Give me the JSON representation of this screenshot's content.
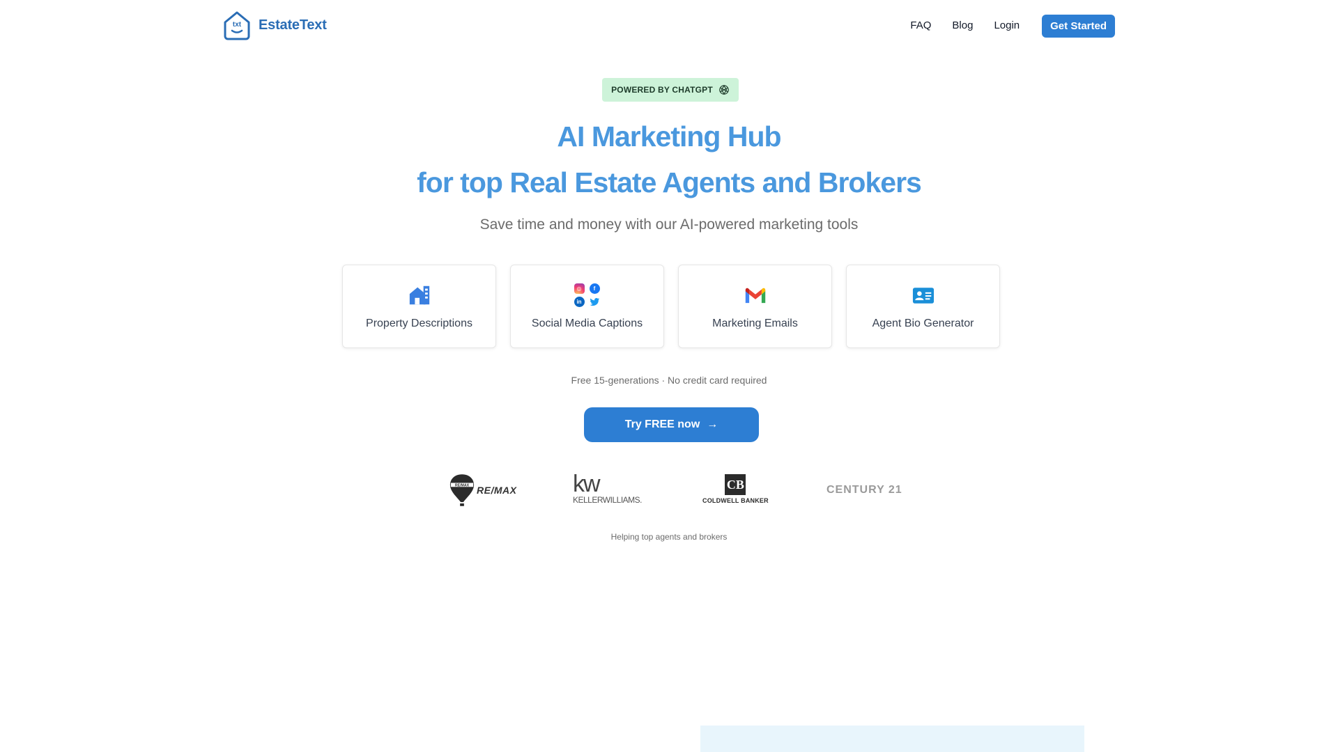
{
  "nav": {
    "logo_text": "EstateText",
    "links": [
      "FAQ",
      "Blog",
      "Login"
    ],
    "cta": "Get Started"
  },
  "badge": {
    "text": "POWERED BY CHATGPT",
    "icon": "openai-icon"
  },
  "hero": {
    "title_line1": "AI Marketing Hub",
    "title_line2": "for top Real Estate Agents and Brokers",
    "subtitle": "Save time and money with our AI-powered marketing tools"
  },
  "features": [
    {
      "label": "Property Descriptions",
      "icon": "house-icon"
    },
    {
      "label": "Social Media Captions",
      "icon": "social-icons"
    },
    {
      "label": "Marketing Emails",
      "icon": "gmail-icon"
    },
    {
      "label": "Agent Bio Generator",
      "icon": "id-card-icon"
    }
  ],
  "cta": {
    "note": "Free 15-generations · No credit card required",
    "button": "Try FREE now",
    "arrow": "→"
  },
  "brands": {
    "remax": "RE/MAX",
    "kw_mark": "kw",
    "kw_name": "KELLERWILLIAMS.",
    "cb_mark": "CB",
    "cb_name": "COLDWELL BANKER",
    "c21": "CENTURY 21"
  },
  "helping": "Helping top agents and brokers",
  "colors": {
    "brand_blue": "#2d7ed3",
    "hero_blue": "#4a98de",
    "badge_green": "#cdf3d9"
  }
}
